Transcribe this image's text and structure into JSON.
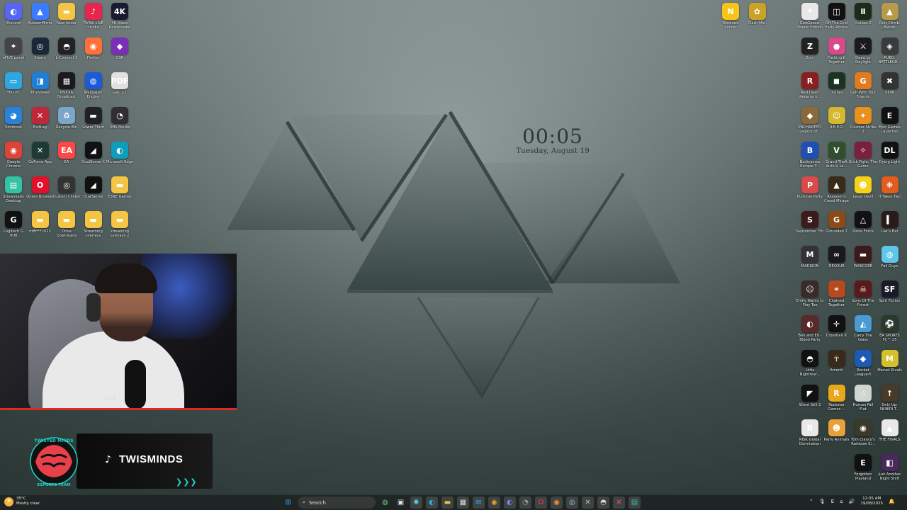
{
  "desktop": {
    "left_icons": [
      {
        "label": "Discord",
        "icon": "discord-icon",
        "color": "#5865F2",
        "g": "◐"
      },
      {
        "label": "ApowerMirror",
        "icon": "apowermirror-icon",
        "color": "#3a7bff",
        "g": "▲"
      },
      {
        "label": "New folder",
        "icon": "folder-icon",
        "color": "#f4c542",
        "g": "▬"
      },
      {
        "label": "TikTok LIVE Studio",
        "icon": "tiktok-live-icon",
        "color": "#e6264f",
        "g": "♪"
      },
      {
        "label": "4K Video Downloader",
        "icon": "4k-downloader-icon",
        "color": "#1a1a2e",
        "g": "4K"
      },
      {
        "label": "eFIVE panel",
        "icon": "panel-icon",
        "color": "#444",
        "g": "✦"
      },
      {
        "label": "Steam",
        "icon": "steam-icon",
        "color": "#1b2838",
        "g": "◎"
      },
      {
        "label": "L-Connect 3",
        "icon": "lconnect-icon",
        "color": "#222",
        "g": "◓"
      },
      {
        "label": "Firefox",
        "icon": "firefox-icon",
        "color": "#ff7139",
        "g": "◉"
      },
      {
        "label": "OSR",
        "icon": "osr-icon",
        "color": "#7a2fb8",
        "g": "◆"
      },
      {
        "label": "This PC",
        "icon": "this-pc-icon",
        "color": "#2fa6e0",
        "g": "▭"
      },
      {
        "label": "UltraViewer",
        "icon": "ultraviewer-icon",
        "color": "#1f7fd6",
        "g": "◨"
      },
      {
        "label": "NVIDIA Broadcast",
        "icon": "nvidia-broadcast-icon",
        "color": "#1a1a1a",
        "g": "▦"
      },
      {
        "label": "Wallpaper Engine",
        "icon": "wallpaper-engine-icon",
        "color": "#1b5bd8",
        "g": "◍"
      },
      {
        "label": "ثابتة علاقة",
        "icon": "pdf-icon",
        "color": "#e0e0e0",
        "g": "PDF"
      },
      {
        "label": "Slimbook",
        "icon": "slimbook-icon",
        "color": "#2a82d8",
        "g": "◕"
      },
      {
        "label": "ExitLag",
        "icon": "exitlag-icon",
        "color": "#c0283a",
        "g": "✕"
      },
      {
        "label": "Recycle Bin",
        "icon": "recycle-bin-icon",
        "color": "#7aa7c7",
        "g": "♻"
      },
      {
        "label": "Lower Third",
        "icon": "lower-third-icon",
        "color": "#222",
        "g": "▬"
      },
      {
        "label": "OBS Studio",
        "icon": "obs-icon",
        "color": "#302e31",
        "g": "◔"
      },
      {
        "label": "Google Chrome",
        "icon": "chrome-icon",
        "color": "#db4437",
        "g": "◉"
      },
      {
        "label": "GeForce App",
        "icon": "geforce-icon",
        "color": "#1e3a33",
        "g": "✕"
      },
      {
        "label": "EA",
        "icon": "ea-icon",
        "color": "#ff4747",
        "g": "EA"
      },
      {
        "label": "DualSense X",
        "icon": "dualsense-icon",
        "color": "#111",
        "g": "◢"
      },
      {
        "label": "Microsoft Edge",
        "icon": "edge-icon",
        "color": "#0c9fbd",
        "g": "◐"
      },
      {
        "label": "Streamlabs Desktop",
        "icon": "streamlabs-icon",
        "color": "#31c3a2",
        "g": "▤"
      },
      {
        "label": "Opera Browser",
        "icon": "opera-icon",
        "color": "#e0112b",
        "g": "O"
      },
      {
        "label": "Custom Clicker",
        "icon": "clicker-icon",
        "color": "#333",
        "g": "◎"
      },
      {
        "label": "DualSense",
        "icon": "dualsense-2-icon",
        "color": "#111",
        "g": "◢"
      },
      {
        "label": "ESNE Games",
        "icon": "folder-icon",
        "color": "#f4c542",
        "g": "▬"
      },
      {
        "label": "Logitech G HUB",
        "icon": "ghub-icon",
        "color": "#111",
        "g": "G"
      },
      {
        "label": "mBFFF2022",
        "icon": "folder-icon",
        "color": "#f4c542",
        "g": "▬"
      },
      {
        "label": "Drive Downloads",
        "icon": "folder-icon",
        "color": "#f4c542",
        "g": "▬"
      },
      {
        "label": "Streaming overlays",
        "icon": "folder-icon",
        "color": "#f4c542",
        "g": "▬"
      },
      {
        "label": "streaming overlays 2",
        "icon": "folder-icon",
        "color": "#f4c542",
        "g": "▬"
      }
    ],
    "top_mid_icons": [
      {
        "label": "Windows Soccer",
        "icon": "norton-icon",
        "color": "#f5c518",
        "g": "N"
      },
      {
        "label": "Clash Mini",
        "icon": "clash-icon",
        "color": "#c9a227",
        "g": "✿"
      }
    ],
    "right_icons": [
      {
        "label": "GeoGuessr Steam Edition",
        "icon": "geoguessr-icon",
        "color": "#e8e8e8",
        "g": "⌖"
      },
      {
        "label": "Off The Grid Early Access",
        "icon": "offthegrid-icon",
        "color": "#111",
        "g": "◫"
      },
      {
        "label": "Outlast 2",
        "icon": "outlast2-icon",
        "color": "#1d2a1a",
        "g": "Ⅱ"
      },
      {
        "label": "Only Climb: Better Together",
        "icon": "onlyclimb-icon",
        "color": "#b59b4a",
        "g": "▲"
      },
      {
        "label": "Zoin",
        "icon": "zoin-icon",
        "color": "#222",
        "g": "Z"
      },
      {
        "label": "Pushing It Together",
        "icon": "pushing-icon",
        "color": "#d94a8c",
        "g": "●"
      },
      {
        "label": "Dead by Daylight",
        "icon": "dbd-icon",
        "color": "#1a1a1a",
        "g": "⚔"
      },
      {
        "label": "PUBG: BATTLEGR...",
        "icon": "pubg-icon",
        "color": "#3b3b3b",
        "g": "◈"
      },
      {
        "label": "Red Dead Redempti...",
        "icon": "rdr-icon",
        "color": "#8b1e1e",
        "g": "R"
      },
      {
        "label": "Outlast",
        "icon": "outlast-icon",
        "color": "#1d3322",
        "g": "◼"
      },
      {
        "label": "Golf With Your Friends",
        "icon": "golf-icon",
        "color": "#e07b1f",
        "g": "G"
      },
      {
        "label": "V696",
        "icon": "v696-icon",
        "color": "#333",
        "g": "✖"
      },
      {
        "label": "UNCHARTED: Legacy of...",
        "icon": "uncharted-icon",
        "color": "#8a6a3a",
        "g": "◆"
      },
      {
        "label": "R.E.P.O.",
        "icon": "repo-icon",
        "color": "#d4b92c",
        "g": "☺"
      },
      {
        "label": "Counter-Strike 2",
        "icon": "cs2-icon",
        "color": "#e8911c",
        "g": "✦"
      },
      {
        "label": "Epic Games Launcher",
        "icon": "epic-icon",
        "color": "#111",
        "g": "E"
      },
      {
        "label": "Backrooms Escape T...",
        "icon": "backrooms-icon",
        "color": "#1d4fb5",
        "g": "B"
      },
      {
        "label": "Grand Theft Auto V Le...",
        "icon": "gta-icon",
        "color": "#2f4f2f",
        "g": "V"
      },
      {
        "label": "Stick Fight: The Game",
        "icon": "stickfight-icon",
        "color": "#7a1f3d",
        "g": "✧"
      },
      {
        "label": "Dying Light",
        "icon": "dyinglight-icon",
        "color": "#111",
        "g": "DL"
      },
      {
        "label": "Pummel Party",
        "icon": "pummel-icon",
        "color": "#d94a4a",
        "g": "P"
      },
      {
        "label": "Assassin's Creed Mirage",
        "icon": "ac-icon",
        "color": "#3a2a1a",
        "g": "▲"
      },
      {
        "label": "Level Devil",
        "icon": "leveldevil-icon",
        "color": "#f5d21a",
        "g": "☻"
      },
      {
        "label": "It Takes Two",
        "icon": "ittakestwo-icon",
        "color": "#e45b1e",
        "g": "❋"
      },
      {
        "label": "September 7th",
        "icon": "september-icon",
        "color": "#3a1a1a",
        "g": "S"
      },
      {
        "label": "Grounded 2",
        "icon": "grounded-icon",
        "color": "#8b4a1a",
        "g": "G"
      },
      {
        "label": "Delta Force",
        "icon": "deltaforce-icon",
        "color": "#111",
        "g": "△"
      },
      {
        "label": "Liar's Bar",
        "icon": "liarsbar-icon",
        "color": "#2a1a1a",
        "g": "▍"
      },
      {
        "label": "MADISON",
        "icon": "madison-icon",
        "color": "#333",
        "g": "M"
      },
      {
        "label": "DEVOUR",
        "icon": "devour-icon",
        "color": "#1a1a1a",
        "g": "∞"
      },
      {
        "label": "PANICORE",
        "icon": "panicore-icon",
        "color": "#3a1a1a",
        "g": "▬"
      },
      {
        "label": "Fall Guys",
        "icon": "fallguys-icon",
        "color": "#5ec6e8",
        "g": "◍"
      },
      {
        "label": "Emily Wants to Play Too",
        "icon": "emily-icon",
        "color": "#3a2a2a",
        "g": "☹"
      },
      {
        "label": "Chained Together",
        "icon": "chained-icon",
        "color": "#b5491f",
        "g": "⚭"
      },
      {
        "label": "Sons Of The Forest",
        "icon": "sotf-icon",
        "color": "#5a1a1a",
        "g": "☠"
      },
      {
        "label": "Split Fiction",
        "icon": "splitfiction-icon",
        "color": "#1a1a2a",
        "g": "SF"
      },
      {
        "label": "Ben and Ed - Blood Party",
        "icon": "benandeds-icon",
        "color": "#5a2a2a",
        "g": "◐"
      },
      {
        "label": "Crosshair X",
        "icon": "crosshair-icon",
        "color": "#111",
        "g": "✛"
      },
      {
        "label": "Carry The Glass",
        "icon": "carryglass-icon",
        "color": "#4a9ad4",
        "g": "◭"
      },
      {
        "label": "EA SPORTS FC™ 25",
        "icon": "fc25-icon",
        "color": "#2a3a2a",
        "g": "⚽"
      },
      {
        "label": "Little Nightmar...",
        "icon": "littlenightmares-icon",
        "color": "#111",
        "g": "◓"
      },
      {
        "label": "Amenti",
        "icon": "amenti-icon",
        "color": "#3a2a1a",
        "g": "☥"
      },
      {
        "label": "Rocket League®",
        "icon": "rocketleague-icon",
        "color": "#1d5ab5",
        "g": "◆"
      },
      {
        "label": "Marvel Rivals",
        "icon": "marvelrivals-icon",
        "color": "#d4c02a",
        "g": "M"
      },
      {
        "label": "Silent Still 2",
        "icon": "silentstill-icon",
        "color": "#111",
        "g": "◤"
      },
      {
        "label": "Rockstar Games ...",
        "icon": "rockstar-icon",
        "color": "#e9a71e",
        "g": "R"
      },
      {
        "label": "Human Fall Flat",
        "icon": "humanfallflat-icon",
        "color": "#cfd6d2",
        "g": "☃"
      },
      {
        "label": "Only Up: SKIBIDI T...",
        "icon": "onlyup-icon",
        "color": "#4a3a2a",
        "g": "↑"
      },
      {
        "label": "RISK Global Domination",
        "icon": "risk-icon",
        "color": "#e8e8e8",
        "g": "R"
      },
      {
        "label": "Party Animals",
        "icon": "partyanimals-icon",
        "color": "#e8a13a",
        "g": "☻"
      },
      {
        "label": "Tom Clancy's Rainbow Si...",
        "icon": "r6-icon",
        "color": "#3a3a2a",
        "g": "◉"
      },
      {
        "label": "THE FINALS",
        "icon": "thefinals-icon",
        "color": "#e8e8e8",
        "g": "▲"
      },
      {
        "label": "Forgotten Playland",
        "icon": "forgottenplayland-icon",
        "color": "#111",
        "g": "E"
      },
      {
        "label": "Just Another Night Shift",
        "icon": "nightshift-icon",
        "color": "#4a2a5a",
        "g": "◧"
      }
    ]
  },
  "clock": {
    "time": "00:05",
    "date": "Tuesday, August 19"
  },
  "webcam": {
    "watermark": "مُعتز"
  },
  "brand": {
    "handle": "TWISMINDS",
    "logo_top": "TWISTED MINDS",
    "logo_bottom": "ESPORTS TEAM"
  },
  "taskbar": {
    "weather_temp": "35°C",
    "weather_desc": "Mostly clear",
    "search_placeholder": "Search",
    "apps": [
      {
        "icon": "start-icon",
        "g": "⊞",
        "color": "#3aa0ff"
      },
      {
        "icon": "search-icon",
        "g": "⌕",
        "color": "#fff"
      },
      {
        "icon": "widgets-icon",
        "g": "◍",
        "color": "#6fbf6f"
      },
      {
        "icon": "task-view-icon",
        "g": "▣",
        "color": "#ddd"
      },
      {
        "icon": "copilot-icon",
        "g": "✺",
        "color": "#5ad1e8"
      },
      {
        "icon": "edge-taskbar-icon",
        "g": "◐",
        "color": "#33b0d8"
      },
      {
        "icon": "file-explorer-icon",
        "g": "▬",
        "color": "#f4c542"
      },
      {
        "icon": "store-icon",
        "g": "▦",
        "color": "#ddd"
      },
      {
        "icon": "mail-icon",
        "g": "✉",
        "color": "#3aa0ff"
      },
      {
        "icon": "chrome-taskbar-icon",
        "g": "◉",
        "color": "#e8a13a"
      },
      {
        "icon": "discord-taskbar-icon",
        "g": "◐",
        "color": "#7c86ff"
      },
      {
        "icon": "obs-taskbar-icon",
        "g": "◔",
        "color": "#aaa"
      },
      {
        "icon": "opera-taskbar-icon",
        "g": "O",
        "color": "#ff3a4a"
      },
      {
        "icon": "firefox-taskbar-icon",
        "g": "◉",
        "color": "#ff8a3a"
      },
      {
        "icon": "steam-taskbar-icon",
        "g": "◎",
        "color": "#9fc7e8"
      },
      {
        "icon": "geforce-taskbar-icon",
        "g": "✕",
        "color": "#bbb"
      },
      {
        "icon": "lconnect-taskbar-icon",
        "g": "◓",
        "color": "#ddd"
      },
      {
        "icon": "exitlag-taskbar-icon",
        "g": "✕",
        "color": "#ff4a5a"
      },
      {
        "icon": "streamlabs-taskbar-icon",
        "g": "▤",
        "color": "#31c3a2"
      }
    ],
    "tray_time": "12:05 AM",
    "tray_date": "19/08/2025",
    "tray_lang": "E"
  }
}
